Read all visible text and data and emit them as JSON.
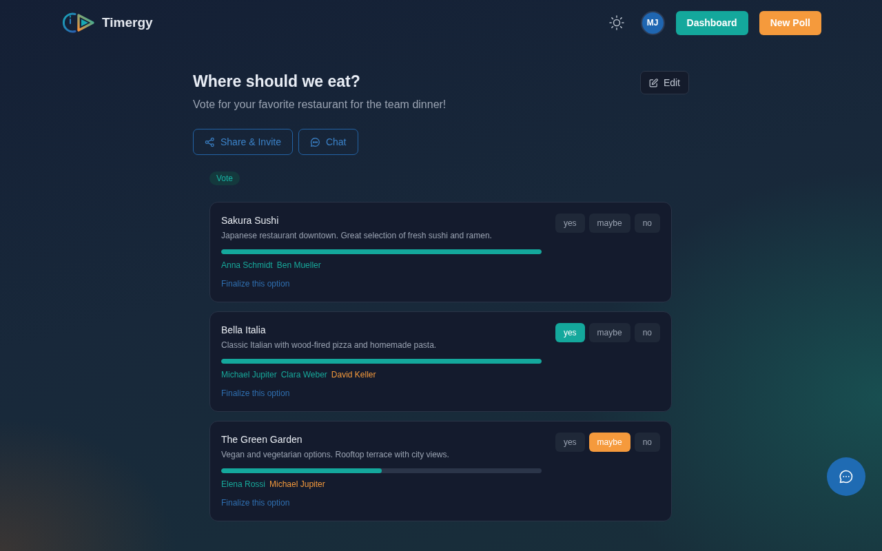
{
  "brand": {
    "name": "Timergy"
  },
  "nav": {
    "avatar_initials": "MJ",
    "buttons": [
      {
        "label": "Dashboard",
        "kind": "primary"
      },
      {
        "label": "New Poll",
        "kind": "accent"
      }
    ]
  },
  "poll": {
    "title": "Where should we eat?",
    "description": "Vote for your favorite restaurant for the team dinner!",
    "edit_label": "Edit"
  },
  "actions": [
    {
      "label": "Share & Invite",
      "kind": "share"
    },
    {
      "label": "Chat",
      "kind": "chat"
    }
  ],
  "tabs": [
    {
      "label": "Vote",
      "selected": true
    }
  ],
  "options": [
    {
      "name": "Sakura Sushi",
      "description": "Japanese restaurant downtown. Great selection of fresh sushi and ramen.",
      "level": 1,
      "voters": [
        {
          "name": "Anna Schmidt",
          "color": "#17a99b"
        },
        {
          "name": "Ben Mueller",
          "color": "#17a99b"
        }
      ],
      "responses": [
        {
          "label": "yes",
          "kind": "yes",
          "selected": false
        },
        {
          "label": "maybe",
          "kind": "maybe",
          "selected": false
        },
        {
          "label": "no",
          "kind": "no",
          "selected": false
        }
      ],
      "finalize_label": "Finalize this option"
    },
    {
      "name": "Bella Italia",
      "description": "Classic Italian with wood-fired pizza and homemade pasta.",
      "level": 1,
      "voters": [
        {
          "name": "Michael Jupiter",
          "color": "#17a99b"
        },
        {
          "name": "Clara Weber",
          "color": "#17a99b"
        },
        {
          "name": "David Keller",
          "color": "#f59a3c"
        }
      ],
      "responses": [
        {
          "label": "yes",
          "kind": "yes",
          "selected": true
        },
        {
          "label": "maybe",
          "kind": "maybe",
          "selected": false
        },
        {
          "label": "no",
          "kind": "no",
          "selected": false
        }
      ],
      "finalize_label": "Finalize this option"
    },
    {
      "name": "The Green Garden",
      "description": "Vegan and vegetarian options. Rooftop terrace with city views.",
      "level": 0.5,
      "voters": [
        {
          "name": "Elena Rossi",
          "color": "#17a99b"
        },
        {
          "name": "Michael Jupiter",
          "color": "#f59a3c"
        }
      ],
      "responses": [
        {
          "label": "yes",
          "kind": "yes",
          "selected": false
        },
        {
          "label": "maybe",
          "kind": "maybe",
          "selected": true
        },
        {
          "label": "no",
          "kind": "no",
          "selected": false
        }
      ],
      "finalize_label": "Finalize this option"
    }
  ]
}
